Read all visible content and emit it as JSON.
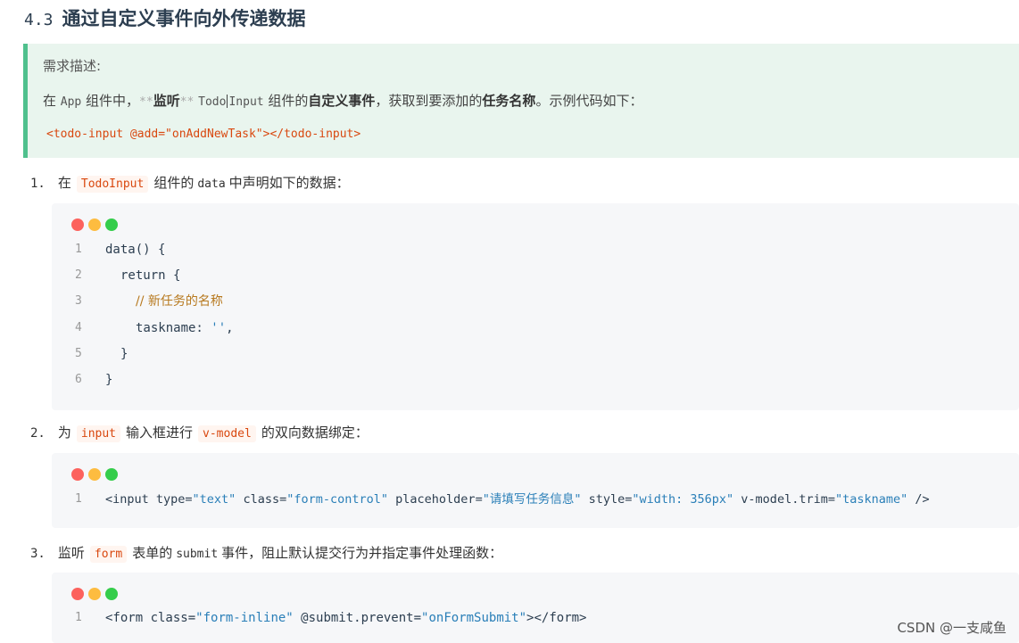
{
  "heading": {
    "number": "4.3",
    "title": "通过自定义事件向外传递数据"
  },
  "callout": {
    "label": "需求描述:",
    "text_prefix": "在 ",
    "app_code": "App",
    "text_mid1": " 组件中，",
    "stars_open": "**",
    "listen_bold": "监听",
    "stars_close": "**",
    "todo_code_a": "Todo",
    "todo_code_b": "Input",
    "text_mid2": " 组件的",
    "custom_event_bold": "自定义事件",
    "text_mid3": "，获取到要添加的",
    "task_name_bold": "任务名称",
    "text_suffix": "。示例代码如下：",
    "example_code": "<todo-input @add=\"onAddNewTask\"></todo-input>"
  },
  "steps": [
    {
      "num": "1.",
      "pre": "在",
      "pill": "TodoInput",
      "mid": "组件的",
      "code": "data",
      "post": "中声明如下的数据："
    },
    {
      "num": "2.",
      "pre": "为",
      "pill": "input",
      "mid": "输入框进行",
      "pill2": "v-model",
      "post": "的双向数据绑定："
    },
    {
      "num": "3.",
      "pre": "监听",
      "pill": "form",
      "mid": "表单的",
      "code": "submit",
      "post": "事件，阻止默认提交行为并指定事件处理函数："
    }
  ],
  "code1": {
    "line_numbers": [
      "1",
      "2",
      "3",
      "4",
      "5",
      "6"
    ],
    "l1": "data() {",
    "l2": "return {",
    "l3": "// 新任务的名称",
    "l4_key": "taskname: ",
    "l4_val": "''",
    "l4_end": ",",
    "l5": "}",
    "l6": "}"
  },
  "code2": {
    "line_number": "1",
    "t1": "<input ",
    "a1": "type=",
    "v1": "\"text\"",
    "a2": " class=",
    "v2": "\"form-control\"",
    "a3": " placeholder=",
    "v3": "\"请填写任务信息\"",
    "a4": " style=",
    "v4": "\"width: 356px\"",
    "a5": " v-model.trim=",
    "v5": "\"taskname\"",
    "t2": " />"
  },
  "code3": {
    "line_number": "1",
    "t1": "<form ",
    "a1": "class=",
    "v1": "\"form-inline\"",
    "a2": " @submit.prevent=",
    "v2": "\"onFormSubmit\"",
    "t2": "></form>"
  },
  "watermark": "CSDN @一支咸鱼",
  "colors": {
    "accent": "#4fc08d",
    "pill_text": "#d9480f",
    "string": "#2a7fb8",
    "comment": "#b7791f"
  }
}
